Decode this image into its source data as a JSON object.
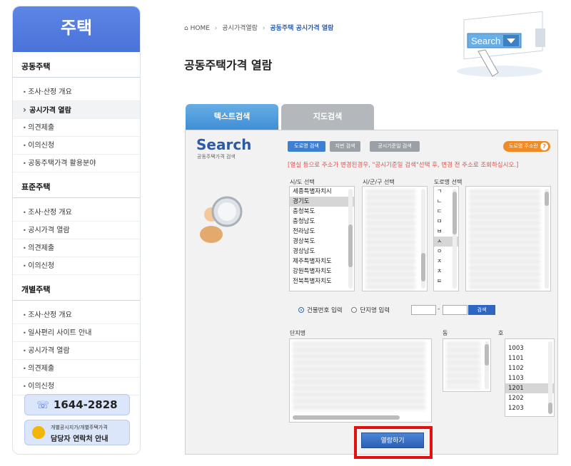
{
  "sidebar": {
    "title": "주택",
    "groups": [
      {
        "title": "공동주택",
        "items": [
          "조사·산정 개요",
          "공시가격 열람",
          "의견제출",
          "이의신청",
          "공동주택가격 활용분야"
        ]
      },
      {
        "title": "표준주택",
        "items": [
          "조사·산정 개요",
          "공시가격 열람",
          "의견제출",
          "이의신청"
        ]
      },
      {
        "title": "개별주택",
        "items": [
          "조사·산정 개요",
          "일사편리 사이트 안내",
          "공시가격 열람",
          "의견제출",
          "이의신청"
        ]
      }
    ],
    "phone": "1644-2828",
    "contact_line1": "개별공시지가/개별주택가격",
    "contact_line2": "담당자 연락처 안내"
  },
  "breadcrumb": {
    "home": "HOME",
    "level1": "공시가격열람",
    "current": "공동주택 공시가격 열람"
  },
  "page_title": "공동주택가격 열람",
  "hero_text": "Search",
  "tabs": {
    "text_search": "텍스트검색",
    "map_search": "지도검색"
  },
  "panel": {
    "logo": "Search",
    "logo_sub": "공동주택가격 검색",
    "btn_road": "도로명 검색",
    "btn_lot": "지번 검색",
    "btn_date": "공시기준일 검색",
    "road_guide": "도로명 주소란",
    "notice": "[열실 등으로 주소가 변경된경우, \"공시기준일 검색\"선택 후, 변경 전 주소로 조회하십시오.]",
    "label_sido": "시/도 선택",
    "label_sigungu": "시/군/구 선택",
    "label_road": "도로명 선택",
    "sido_list": [
      "세종특별자치시",
      "경기도",
      "충청북도",
      "충청남도",
      "전라남도",
      "경상북도",
      "경상남도",
      "제주특별자치도",
      "강원특별자치도",
      "전북특별자치도"
    ],
    "sido_selected": "경기도",
    "consonants": [
      "ㄱ",
      "ㄴ",
      "ㄷ",
      "ㅁ",
      "ㅂ",
      "ㅅ",
      "ㅇ",
      "ㅈ",
      "ㅊ",
      "ㅌ"
    ],
    "consonant_selected": "ㅅ",
    "radio_building": "건물번호 입력",
    "radio_complex": "단지명 입력",
    "go_label": "검색",
    "label_complex": "단지명",
    "label_dong": "동",
    "label_ho": "호",
    "ho_list": [
      "1003",
      "1101",
      "1102",
      "1103",
      "1201",
      "1202",
      "1203"
    ],
    "ho_selected": "1201",
    "open_button": "열람하기"
  }
}
